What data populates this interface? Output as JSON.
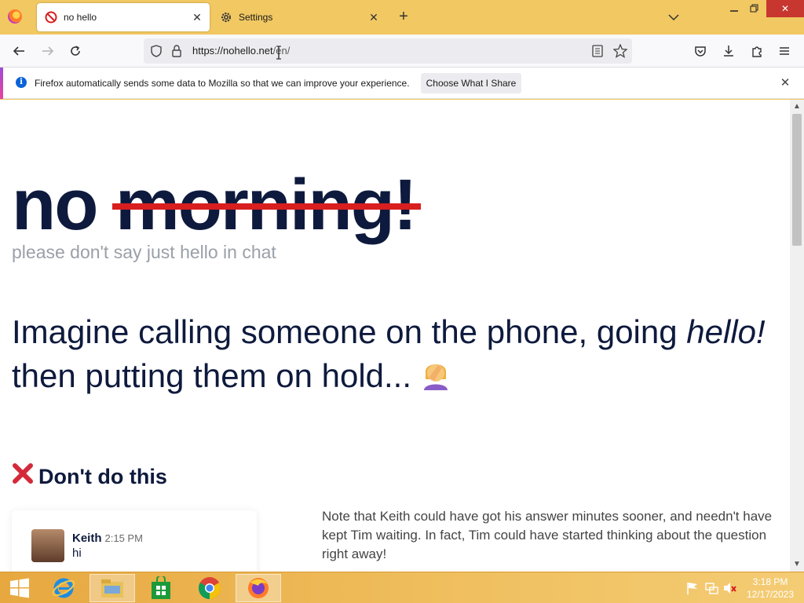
{
  "browser": {
    "tabs": [
      {
        "label": "no hello",
        "icon": "no-entry-icon",
        "active": true
      },
      {
        "label": "Settings",
        "icon": "gear-icon",
        "active": false
      }
    ],
    "url_host": "https://nohello.net",
    "url_path": "/en/",
    "notification": {
      "message": "Firefox automatically sends some data to Mozilla so that we can improve your experience.",
      "button": "Choose What I Share"
    }
  },
  "page": {
    "headline_prefix": "no",
    "headline_struck": "morning!",
    "subtitle": "please don't say just hello in chat",
    "lead_part1": "Imagine calling someone on the phone, going",
    "lead_emphasis": "hello!",
    "lead_part2": "then putting them on hold...",
    "section_heading": "Don't do this",
    "section_icon": "cross-mark-icon",
    "chat": {
      "name": "Keith",
      "time": "2:15 PM",
      "message": "hi"
    },
    "note": "Note that Keith could have got his answer minutes sooner, and needn't have kept Tim waiting. In fact, Tim could have started thinking about the question right away!"
  },
  "taskbar": {
    "apps": [
      "windows-start",
      "internet-explorer",
      "file-explorer",
      "store",
      "chrome",
      "firefox"
    ],
    "clock_time": "3:18 PM",
    "clock_date": "12/17/2023"
  },
  "colors": {
    "accent_navy": "#0e1a3d",
    "strike_red": "#d81e1e",
    "titlebar": "#f1c862",
    "info_blue": "#0b63d8"
  }
}
